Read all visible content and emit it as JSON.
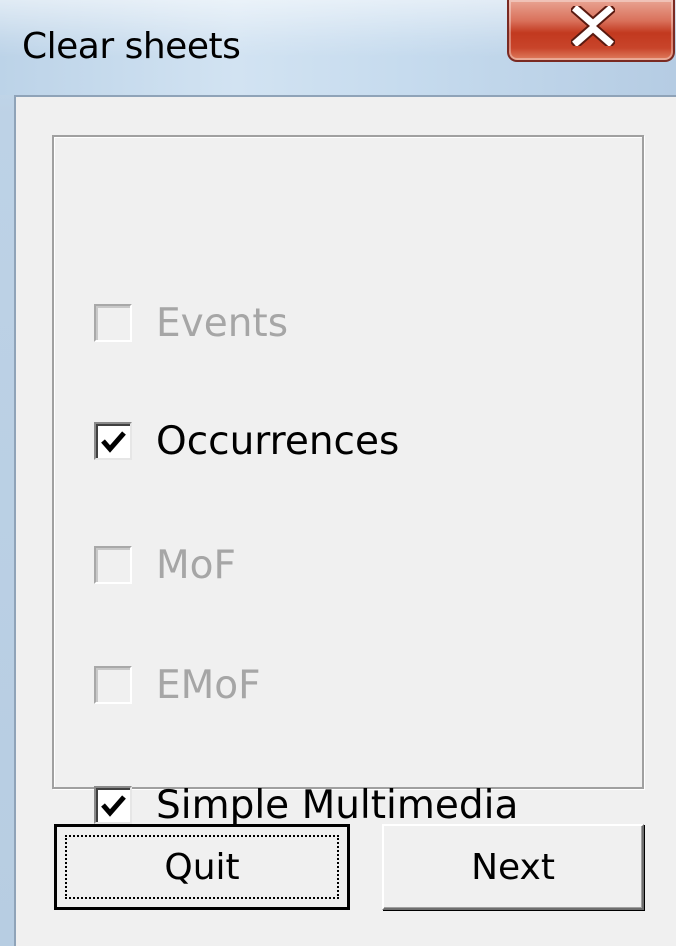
{
  "window": {
    "title": "Clear sheets"
  },
  "checkboxes": [
    {
      "label": "Events",
      "checked": false,
      "enabled": false
    },
    {
      "label": "Occurrences",
      "checked": true,
      "enabled": true
    },
    {
      "label": "MoF",
      "checked": false,
      "enabled": false
    },
    {
      "label": "EMoF",
      "checked": false,
      "enabled": false
    },
    {
      "label": "Simple Multimedia",
      "checked": true,
      "enabled": true
    }
  ],
  "buttons": {
    "quit_label": "Quit",
    "next_label": "Next"
  },
  "icons": {
    "close": "close-icon",
    "check": "check-mark-icon"
  },
  "colors": {
    "close_button": "#c2391f",
    "disabled_text": "#a6a6a6",
    "dialog_background": "#f0f0f0"
  }
}
